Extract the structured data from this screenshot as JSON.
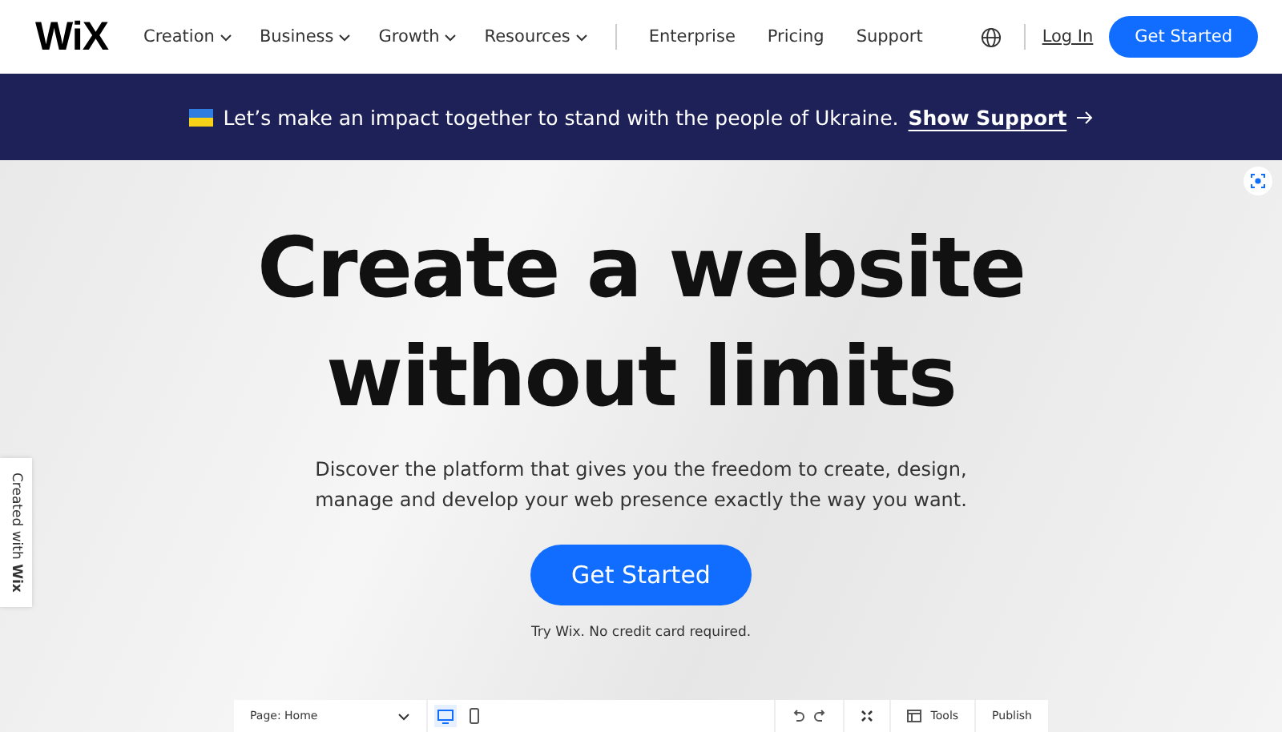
{
  "header": {
    "logo": "WiX",
    "nav": [
      {
        "label": "Creation",
        "kind": "menu"
      },
      {
        "label": "Business",
        "kind": "menu"
      },
      {
        "label": "Growth",
        "kind": "menu"
      },
      {
        "label": "Resources",
        "kind": "menu"
      }
    ],
    "links": [
      "Enterprise",
      "Pricing",
      "Support"
    ],
    "login": "Log In",
    "cta": "Get Started"
  },
  "banner": {
    "text": "Let’s make an impact together to stand with the people of Ukraine.",
    "link": "Show Support"
  },
  "hero": {
    "title_lines": [
      "Create a website",
      "without limits"
    ],
    "subtitle_lines": [
      "Discover the platform that gives you the freedom to create, design,",
      "manage and develop your web presence exactly the way you want."
    ],
    "cta": "Get Started",
    "note": "Try Wix. No credit card required."
  },
  "side_tab": {
    "text": "Created with",
    "brand": "Wix"
  },
  "editor_bar": {
    "page": "Page: Home",
    "devices": [
      {
        "kind": "desktop",
        "selected": true
      },
      {
        "kind": "mobile",
        "selected": false
      }
    ],
    "tools": "Tools",
    "publish": "Publish"
  }
}
